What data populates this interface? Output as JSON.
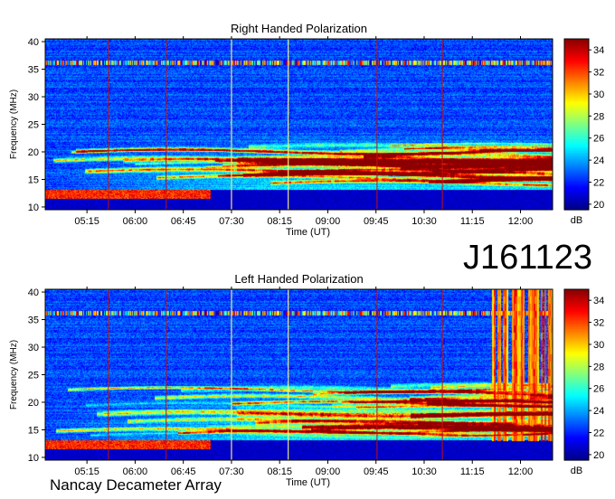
{
  "figure": {
    "day_label": "J161123",
    "footer": "Nancay Decameter Array"
  },
  "chart_data": [
    {
      "type": "heatmap",
      "title": "Right Handed Polarization",
      "xlabel": "Time (UT)",
      "ylabel": "Frequency (MHz)",
      "x_ticks": [
        "05:15",
        "06:00",
        "06:45",
        "07:30",
        "08:15",
        "09:00",
        "09:45",
        "10:30",
        "11:15",
        "12:00"
      ],
      "xlim": [
        "04:36",
        "12:30"
      ],
      "y_ticks": [
        10,
        15,
        20,
        25,
        30,
        35,
        40
      ],
      "ylim": [
        9.5,
        40.5
      ],
      "colorbar": {
        "label": "dB",
        "ticks": [
          20,
          22,
          24,
          26,
          28,
          30,
          32,
          34
        ],
        "range": [
          19.5,
          35
        ]
      },
      "colormap": [
        "#00008b",
        "#0000ff",
        "#0080ff",
        "#00ffff",
        "#80ff80",
        "#ffff00",
        "#ff8000",
        "#ff0000",
        "#8b0000"
      ],
      "grid": false,
      "features": {
        "noise_floor_db": 22.5,
        "low_freq_floor_mhz": 13.2,
        "low_freq_floor_db": 20.5,
        "horizontal_interference_mhz": [
          36.0,
          36.4
        ],
        "vertical_marker_times": [
          "05:35",
          "06:29",
          "07:30",
          "09:46",
          "10:47"
        ],
        "bright_vertical_times": [
          "07:30",
          "08:23"
        ],
        "burst": null
      }
    },
    {
      "type": "heatmap",
      "title": "Left Handed Polarization",
      "xlabel": "Time (UT)",
      "ylabel": "Frequency (MHz)",
      "x_ticks": [
        "05:15",
        "06:00",
        "06:45",
        "07:30",
        "08:15",
        "09:00",
        "09:45",
        "10:30",
        "11:15",
        "12:00"
      ],
      "xlim": [
        "04:36",
        "12:30"
      ],
      "y_ticks": [
        10,
        15,
        20,
        25,
        30,
        35,
        40
      ],
      "ylim": [
        9.5,
        40.5
      ],
      "colorbar": {
        "label": "dB",
        "ticks": [
          20,
          22,
          24,
          26,
          28,
          30,
          32,
          34
        ],
        "range": [
          19.5,
          35
        ]
      },
      "colormap": [
        "#00008b",
        "#0000ff",
        "#0080ff",
        "#00ffff",
        "#80ff80",
        "#ffff00",
        "#ff8000",
        "#ff0000",
        "#8b0000"
      ],
      "grid": false,
      "features": {
        "noise_floor_db": 22.5,
        "low_freq_floor_mhz": 13.2,
        "low_freq_floor_db": 20.5,
        "horizontal_interference_mhz": [
          36.0,
          36.4
        ],
        "vertical_marker_times": [
          "05:35",
          "06:29",
          "07:30",
          "09:46",
          "10:47"
        ],
        "bright_vertical_times": [
          "07:30",
          "08:23"
        ],
        "burst": {
          "start": "11:33",
          "end": "12:30",
          "fmin": 13.0,
          "fmax": 40.5,
          "peak_db": 33
        }
      }
    }
  ]
}
